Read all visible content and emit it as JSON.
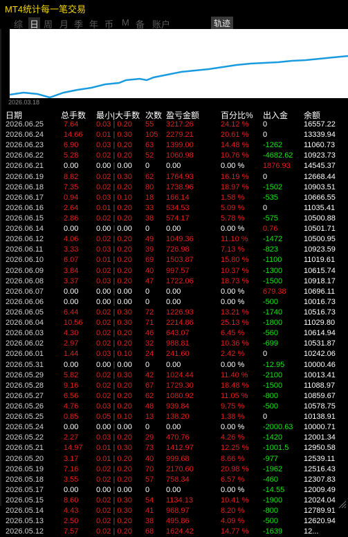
{
  "window": {
    "title": "MT4统计每一笔交易"
  },
  "tabs": [
    "综",
    "日",
    "周",
    "月",
    "季",
    "年",
    "币",
    "M",
    "备",
    "账户"
  ],
  "active_tab": 1,
  "track_button": "轨迹",
  "chart": {
    "start_date": "2026.03.18"
  },
  "columns": [
    "日期",
    "总手数",
    "最小|大手数",
    "次数",
    "盈亏金额",
    "百分比%",
    "出入金",
    "余额"
  ],
  "rows": [
    [
      "2026.06.25",
      "7.64",
      "0.03",
      "0.20",
      "55",
      "3217.26",
      "24.12 %",
      "0",
      "16557.22"
    ],
    [
      "2026.06.24",
      "14.66",
      "0.01",
      "0.30",
      "105",
      "2279.21",
      "20.61 %",
      "0",
      "13339.94"
    ],
    [
      "2026.06.23",
      "6.90",
      "0.03",
      "0.20",
      "63",
      "1399.00",
      "14.48 %",
      "-1262",
      "11060.73"
    ],
    [
      "2026.06.22",
      "5.28",
      "0.02",
      "0.20",
      "52",
      "1060.98",
      "10.76 %",
      "-4682.62",
      "10923.73"
    ],
    [
      "2026.06.21",
      "0.00",
      "0.00",
      "0.00",
      "0",
      "0.00",
      "0.00 %",
      "1876.93",
      "14545.37"
    ],
    [
      "2026.06.19",
      "8.82",
      "0.02",
      "0.30",
      "62",
      "1764.93",
      "16.19 %",
      "0",
      "12668.44"
    ],
    [
      "2026.06.18",
      "7.35",
      "0.02",
      "0.20",
      "80",
      "1738.96",
      "18.97 %",
      "-1502",
      "10903.51"
    ],
    [
      "2026.06.17",
      "0.94",
      "0.03",
      "0.10",
      "18",
      "166.14",
      "1.58 %",
      "-535",
      "10666.55"
    ],
    [
      "2026.06.16",
      "2.64",
      "0.01",
      "0.20",
      "33",
      "534.53",
      "5.09 %",
      "0",
      "11035.41"
    ],
    [
      "2026.06.15",
      "2.86",
      "0.02",
      "0.20",
      "38",
      "574.17",
      "5.78 %",
      "-575",
      "10500.88"
    ],
    [
      "2026.06.14",
      "0.00",
      "0.00",
      "0.00",
      "0",
      "0.00",
      "0.00 %",
      "0.76",
      "10501.71"
    ],
    [
      "2026.06.12",
      "4.06",
      "0.02",
      "0.20",
      "49",
      "1049.36",
      "11.10 %",
      "-1472",
      "10500.95"
    ],
    [
      "2026.06.11",
      "3.33",
      "0.03",
      "0.20",
      "39",
      "726.98",
      "7.13 %",
      "-823",
      "10923.59"
    ],
    [
      "2026.06.10",
      "6.07",
      "0.01",
      "0.20",
      "69",
      "1503.87",
      "15.80 %",
      "-1100",
      "11019.61"
    ],
    [
      "2026.06.09",
      "3.84",
      "0.02",
      "0.20",
      "40",
      "997.57",
      "10.37 %",
      "-1300",
      "10615.74"
    ],
    [
      "2026.06.08",
      "3.37",
      "0.03",
      "0.20",
      "47",
      "1722.06",
      "18.73 %",
      "-1500",
      "10918.17"
    ],
    [
      "2026.06.07",
      "0.00",
      "0.00",
      "0.00",
      "0",
      "0.00",
      "0.00 %",
      "679.38",
      "10696.11"
    ],
    [
      "2026.06.06",
      "0.00",
      "0.00",
      "0.00",
      "0",
      "0.00",
      "0.00 %",
      "-500",
      "10016.73"
    ],
    [
      "2026.06.05",
      "6.44",
      "0.02",
      "0.30",
      "72",
      "1226.93",
      "13.21 %",
      "-1740",
      "10516.73"
    ],
    [
      "2026.06.04",
      "10.56",
      "0.02",
      "0.30",
      "71",
      "2214.86",
      "25.13 %",
      "-1800",
      "11029.80"
    ],
    [
      "2026.06.03",
      "4.30",
      "0.02",
      "0.20",
      "46",
      "643.07",
      "6.45 %",
      "-560",
      "10614.94"
    ],
    [
      "2026.06.02",
      "2.97",
      "0.02",
      "0.20",
      "32",
      "988.81",
      "10.36 %",
      "-699",
      "10531.87"
    ],
    [
      "2026.06.01",
      "1.44",
      "0.03",
      "0.10",
      "24",
      "241.60",
      "2.42 %",
      "0",
      "10242.06"
    ],
    [
      "2026.05.31",
      "0.00",
      "0.00",
      "0.00",
      "0",
      "0.00",
      "0.00 %",
      "-12.95",
      "10000.46"
    ],
    [
      "2026.05.29",
      "5.82",
      "0.02",
      "0.30",
      "42",
      "1024.44",
      "11.40 %",
      "-2100",
      "10013.41"
    ],
    [
      "2026.05.28",
      "9.16",
      "0.02",
      "0.20",
      "67",
      "1729.30",
      "18.48 %",
      "-1500",
      "11088.97"
    ],
    [
      "2026.05.27",
      "6.56",
      "0.02",
      "0.20",
      "62",
      "1080.92",
      "11.05 %",
      "-800",
      "10859.67"
    ],
    [
      "2026.05.26",
      "4.76",
      "0.03",
      "0.20",
      "48",
      "939.84",
      "9.75 %",
      "-500",
      "10578.75"
    ],
    [
      "2026.05.25",
      "0.85",
      "0.05",
      "0.10",
      "13",
      "138.20",
      "1.38 %",
      "0",
      "10138.91"
    ],
    [
      "2026.05.24",
      "0.00",
      "0.00",
      "0.00",
      "0",
      "0.00",
      "0.00 %",
      "-2000.63",
      "10000.71"
    ],
    [
      "2026.05.22",
      "2.27",
      "0.03",
      "0.20",
      "29",
      "470.76",
      "4.26 %",
      "-1420",
      "12001.34"
    ],
    [
      "2026.05.21",
      "14.97",
      "0.01",
      "0.30",
      "73",
      "1412.97",
      "12.25 %",
      "-1001.5",
      "12950.58"
    ],
    [
      "2026.05.20",
      "3.17",
      "0.01",
      "0.20",
      "40",
      "999.68",
      "8.66 %",
      "-977",
      "12539.11"
    ],
    [
      "2026.05.19",
      "7.16",
      "0.02",
      "0.20",
      "70",
      "2170.60",
      "20.98 %",
      "-1962",
      "12516.43"
    ],
    [
      "2026.05.18",
      "3.55",
      "0.02",
      "0.20",
      "57",
      "758.34",
      "6.57 %",
      "-460",
      "12307.83"
    ],
    [
      "2026.05.17",
      "0.00",
      "0.00",
      "0.00",
      "0",
      "0.00",
      "0.00 %",
      "-14.55",
      "12009.49"
    ],
    [
      "2026.05.15",
      "8.60",
      "0.02",
      "0.30",
      "54",
      "1134.13",
      "10.41 %",
      "-1900",
      "12024.04"
    ],
    [
      "2026.05.14",
      "4.43",
      "0.02",
      "0.30",
      "41",
      "968.97",
      "8.20 %",
      "-800",
      "12789.91"
    ],
    [
      "2026.05.13",
      "2.50",
      "0.02",
      "0.20",
      "38",
      "495.86",
      "4.09 %",
      "-500",
      "12620.94"
    ],
    [
      "2026.05.12",
      "7.57",
      "0.02",
      "0.20",
      "68",
      "1624.42",
      "14.77 %",
      "-1639",
      "12..."
    ]
  ],
  "colors": {
    "title": "#f2d500",
    "positive": "#e0201a",
    "neutral": "#ffffff",
    "outflow": "#19e619",
    "chart_line": "#1a9be0",
    "chart_bg": "#ffffff"
  }
}
